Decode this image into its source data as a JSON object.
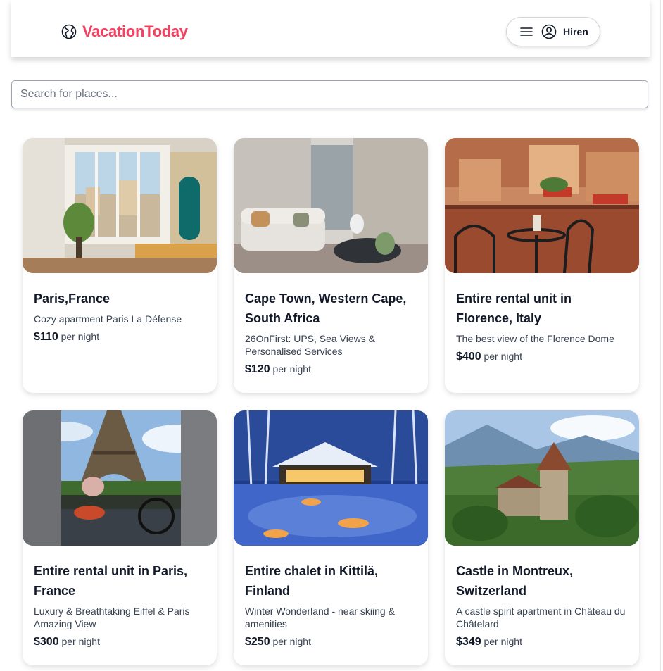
{
  "header": {
    "logo_text": "VacationToday",
    "logo_icon": "globe-icon",
    "menu_icon": "hamburger-menu-icon",
    "avatar_icon": "user-circle-icon",
    "user_name": "Hiren",
    "accent_color": "#f43f5e"
  },
  "search": {
    "placeholder": "Search for places...",
    "value": ""
  },
  "listings": [
    {
      "title": "Paris,France",
      "description": "Cozy apartment Paris La Défense",
      "price": "$110",
      "price_suffix": "per night"
    },
    {
      "title": "Cape Town, Western Cape, South Africa",
      "description": "26OnFirst: UPS, Sea Views & Personalised Services",
      "price": "$120",
      "price_suffix": "per night"
    },
    {
      "title": "Entire rental unit in Florence, Italy",
      "description": "The best view of the Florence Dome",
      "price": "$400",
      "price_suffix": "per night"
    },
    {
      "title": "Entire rental unit in Paris, France",
      "description": "Luxury & Breathtaking Eiffel & Paris Amazing View",
      "price": "$300",
      "price_suffix": "per night"
    },
    {
      "title": "Entire chalet in Kittilä, Finland",
      "description": "Winter Wonderland - near skiing & amenities",
      "price": "$250",
      "price_suffix": "per night"
    },
    {
      "title": "Castle in Montreux, Switzerland",
      "description": "A castle spirit apartment in Château du Châtelard",
      "price": "$349",
      "price_suffix": "per night"
    }
  ]
}
